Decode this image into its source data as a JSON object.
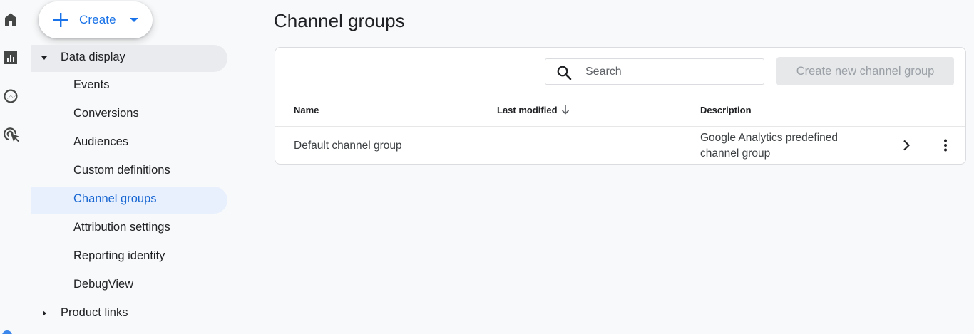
{
  "create_button": {
    "label": "Create",
    "icon": "plus-icon"
  },
  "rail": [
    {
      "name": "home-icon"
    },
    {
      "name": "reports-icon"
    },
    {
      "name": "explore-icon"
    },
    {
      "name": "advertising-icon"
    }
  ],
  "sidebar": {
    "section": {
      "label": "Data display",
      "expanded": true
    },
    "items": [
      {
        "label": "Events"
      },
      {
        "label": "Conversions"
      },
      {
        "label": "Audiences"
      },
      {
        "label": "Custom definitions"
      },
      {
        "label": "Channel groups",
        "active": true
      },
      {
        "label": "Attribution settings"
      },
      {
        "label": "Reporting identity"
      },
      {
        "label": "DebugView"
      }
    ],
    "collapsed_section": {
      "label": "Product links",
      "expanded": false
    }
  },
  "main": {
    "title": "Channel groups",
    "search": {
      "placeholder": "Search",
      "value": ""
    },
    "create_group_label": "Create new channel group",
    "table": {
      "columns": {
        "name": "Name",
        "modified": "Last modified",
        "description": "Description"
      },
      "sort": {
        "column": "Last modified",
        "direction": "descending"
      },
      "rows": [
        {
          "name": "Default channel group",
          "last_modified": "",
          "description": "Google Analytics predefined channel group"
        }
      ]
    }
  },
  "colors": {
    "accent": "#1a73e8",
    "active_bg": "#e8f0fe",
    "active_text": "#1967d2",
    "section_bg": "#e9ebee",
    "disabled_button_bg": "#e7e8ea",
    "disabled_button_text": "#9aa0a6",
    "page_bg": "#f8f9fa"
  }
}
